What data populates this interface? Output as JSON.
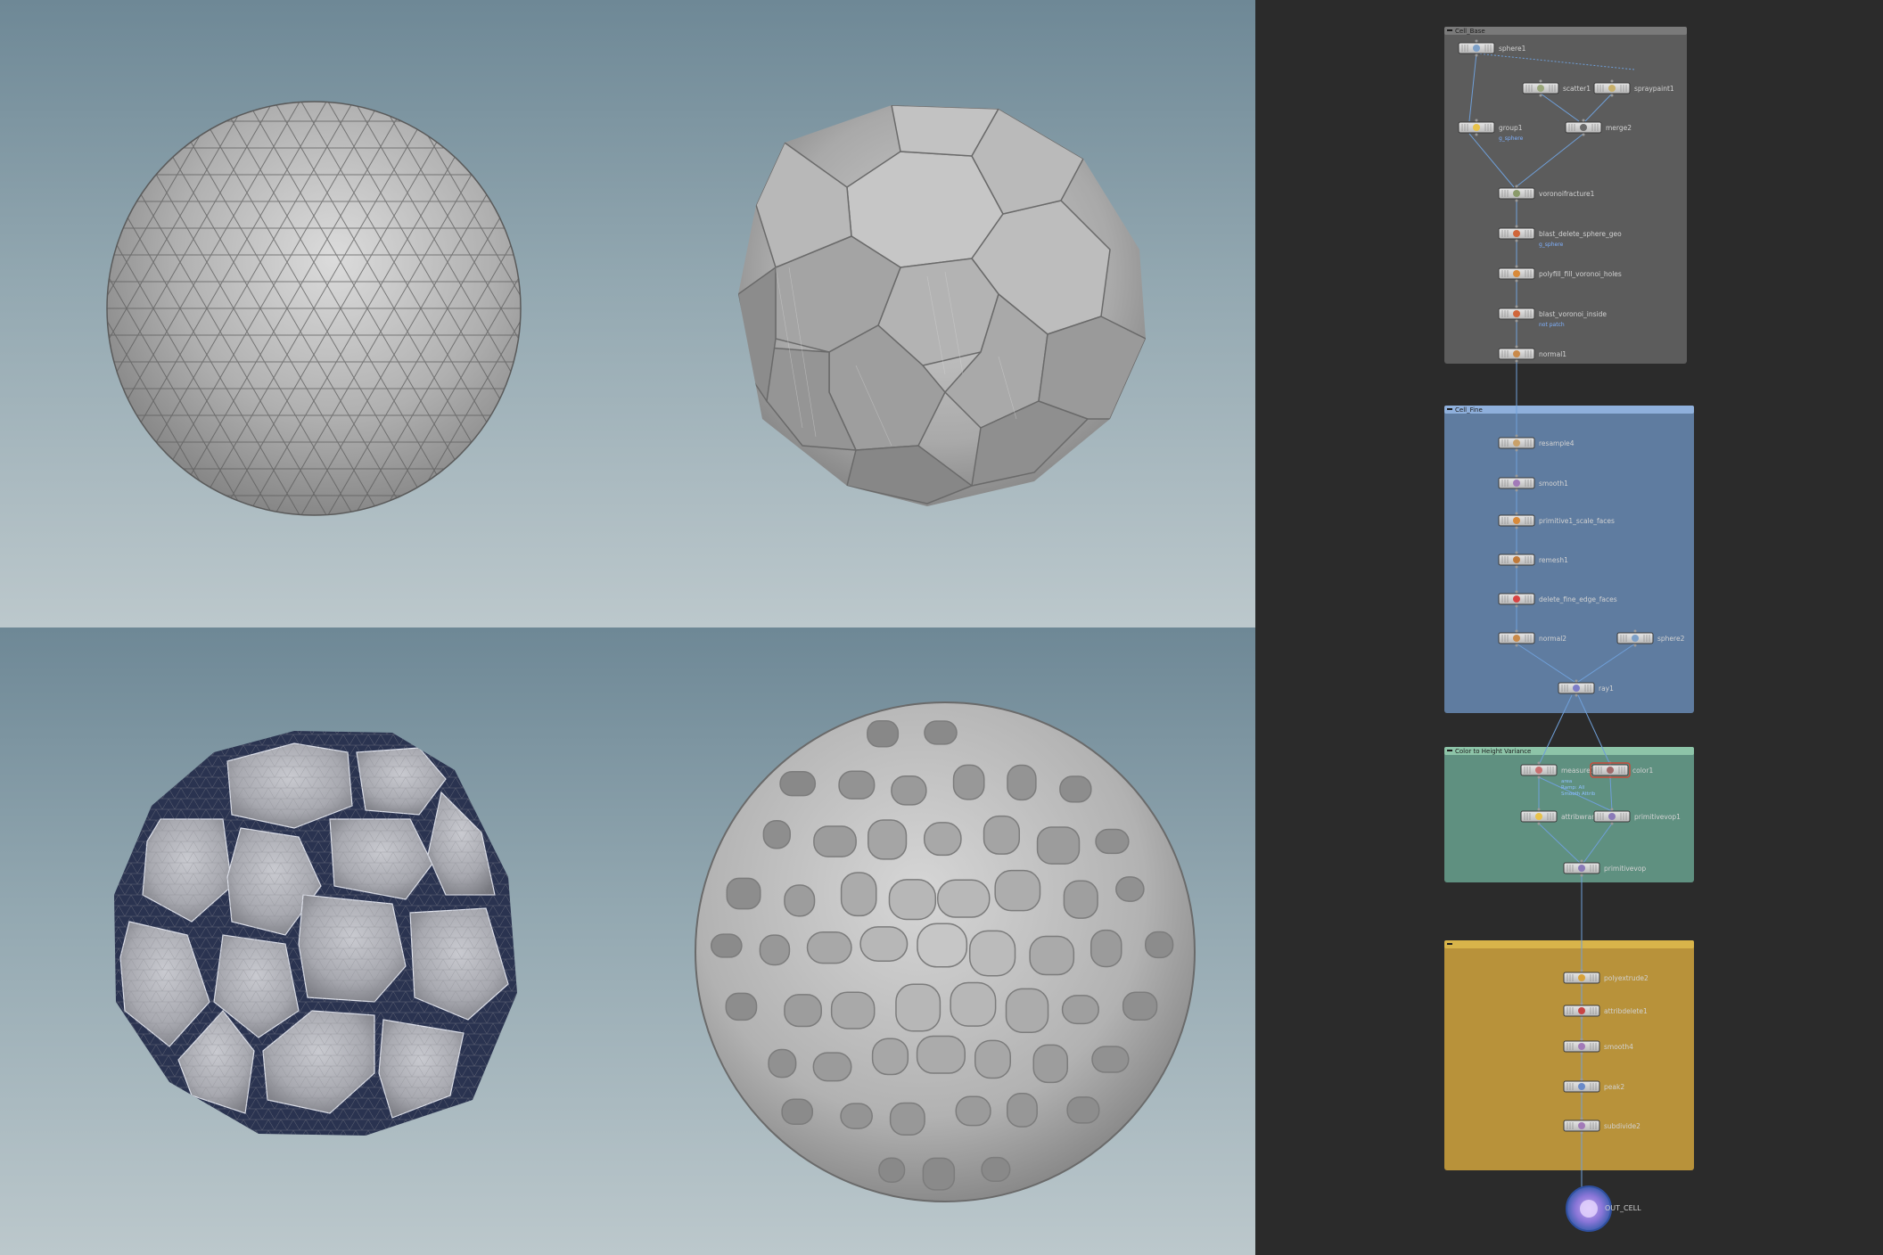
{
  "network": {
    "boxes": [
      {
        "title": "Cell_Base",
        "color": "#5c5c5c",
        "header": "#7a7a7a"
      },
      {
        "title": "Cell_Fine",
        "color": "#5f7ca0",
        "header": "#8fb0dc"
      },
      {
        "title": "Color to Height Variance",
        "color": "#5f9080",
        "header": "#8dc4a8"
      },
      {
        "title": "",
        "color": "#b8923a",
        "header": "#d8b44a"
      }
    ],
    "nodes": {
      "sphere1": "sphere1",
      "scatter1": "scatter1",
      "spraypaint1": "spraypaint1",
      "group1": "group1",
      "group1_note": "g_sphere",
      "merge2": "merge2",
      "voronoifracture1": "voronoifracture1",
      "blast": "blast_delete_sphere_geo",
      "blast_note": "g_sphere",
      "polyfill": "polyfill_fill_voronoi_holes",
      "blast_inside": "blast_voronoi_inside",
      "blast_inside_note": "not patch",
      "normal1": "normal1",
      "resample4": "resample4",
      "smooth1": "smooth1",
      "primitive1": "primitive1_scale_faces",
      "remesh1": "remesh1",
      "delete_fine": "delete_fine_edge_faces",
      "normal2": "normal2",
      "sphere2": "sphere2",
      "ray1": "ray1",
      "measure1": "measure1",
      "measure1_note1": "area",
      "measure1_note2": "Ramp: All",
      "measure1_note3": "Smooth Attrib",
      "color1": "color1",
      "attribwrangle": "attribwrangle",
      "primitivevop1": "primitivevop1",
      "primitivevop": "primitivevop",
      "polyextrude2": "polyextrude2",
      "attribdelete1": "attribdelete1",
      "smooth4": "smooth4",
      "peak2": "peak2",
      "subdivide2": "subdivide2",
      "out": "OUT_CELL"
    }
  },
  "colors": {
    "wire": "#6f9fd8",
    "viewport_top": "#6e8896",
    "viewport_bottom": "#bcc8cc",
    "mesh_gray": "#b3b3b3",
    "cell_gap": "#2a3350"
  },
  "viewports": [
    {
      "name": "triangulated-sphere"
    },
    {
      "name": "voronoi-fractured-sphere"
    },
    {
      "name": "remeshed-cells-sphere"
    },
    {
      "name": "inflated-cells-sphere"
    }
  ]
}
